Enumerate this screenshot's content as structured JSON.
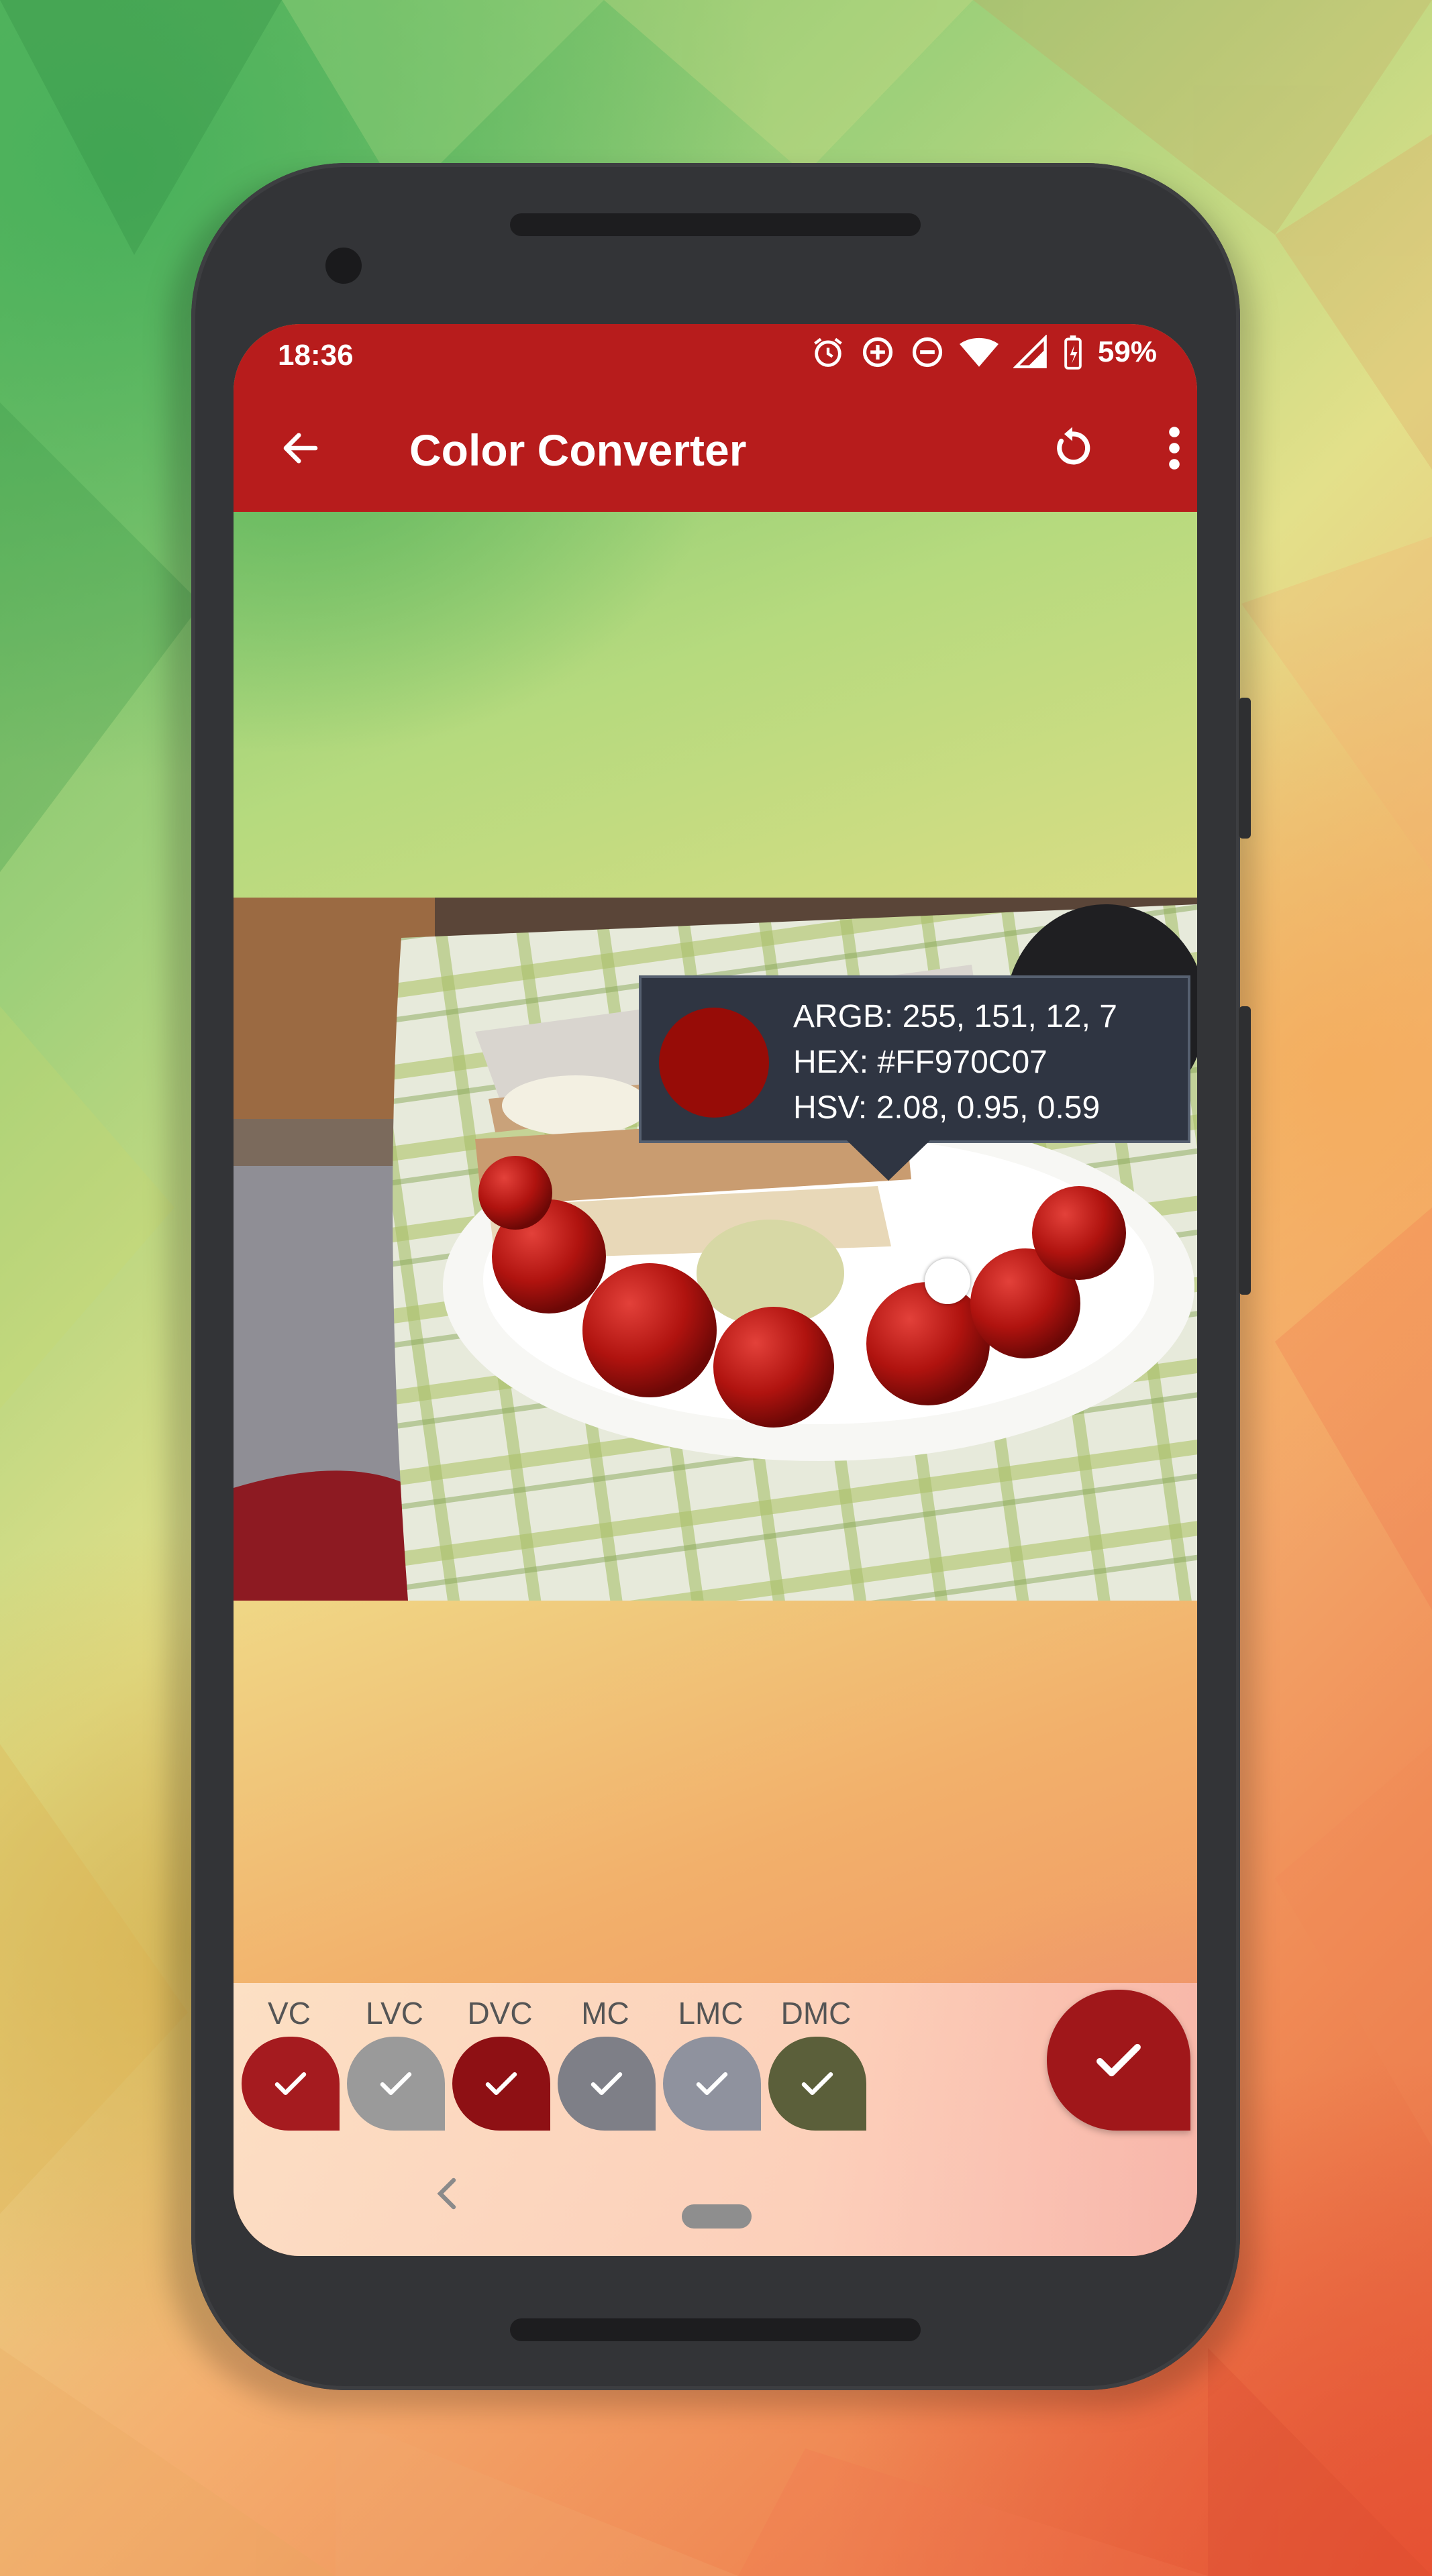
{
  "status_bar": {
    "time": "18:36",
    "battery_percent": "59%",
    "icons": [
      "alarm-icon",
      "data-saver-icon",
      "dnd-icon",
      "wifi-icon",
      "signal-icon",
      "battery-charging-icon"
    ]
  },
  "app_bar": {
    "title": "Color Converter",
    "back_icon": "arrow-left-icon",
    "reset_icon": "refresh-icon",
    "menu_icon": "more-vert-icon"
  },
  "picked_color": {
    "argb": "ARGB: 255, 151, 12, 7",
    "hex": "HEX: #FF970C07",
    "hsv": "HSV: 2.08, 0.95, 0.59",
    "swatch_color": "#970C07"
  },
  "palette": [
    {
      "label": "VC",
      "color": "#a51b1f"
    },
    {
      "label": "LVC",
      "color": "#9a9a9a"
    },
    {
      "label": "DVC",
      "color": "#8e1014"
    },
    {
      "label": "MC",
      "color": "#7e7f87"
    },
    {
      "label": "LMC",
      "color": "#8f929e"
    },
    {
      "label": "DMC",
      "color": "#5b5f3a"
    }
  ],
  "colors": {
    "primary": "#b71c1c",
    "fab": "#a0171a",
    "tooltip_bg": "#2f3542"
  }
}
